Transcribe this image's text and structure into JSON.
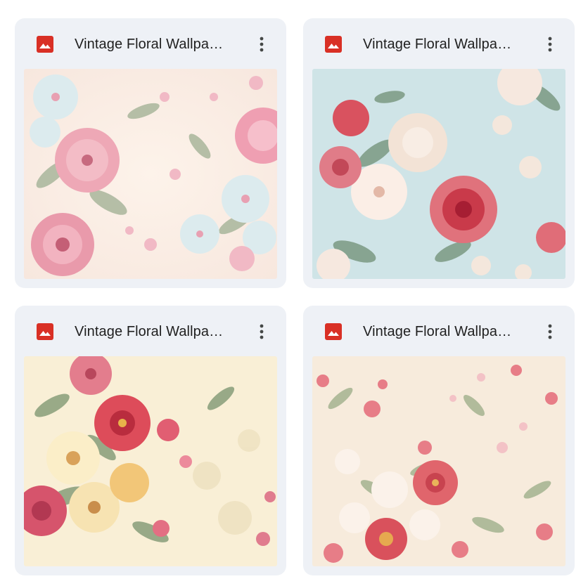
{
  "files": [
    {
      "title": "Vintage Floral Wallpa…",
      "icon": "image-file-icon",
      "menu_icon": "more-vertical-icon",
      "thumbnail_alt": "Vintage floral wallpaper with pink and white flowers on cream"
    },
    {
      "title": "Vintage Floral Wallpa…",
      "icon": "image-file-icon",
      "menu_icon": "more-vertical-icon",
      "thumbnail_alt": "Vintage floral wallpaper with red and cream roses on light blue"
    },
    {
      "title": "Vintage Floral Wallpa…",
      "icon": "image-file-icon",
      "menu_icon": "more-vertical-icon",
      "thumbnail_alt": "Vintage floral wallpaper with red, pink and yellow flowers on cream"
    },
    {
      "title": "Vintage Floral Wallpa…",
      "icon": "image-file-icon",
      "menu_icon": "more-vertical-icon",
      "thumbnail_alt": "Vintage floral wallpaper with small coral blossoms on cream"
    }
  ],
  "colors": {
    "card_bg": "#eef1f6",
    "icon_red": "#d93025",
    "title_text": "#1f1f1f",
    "menu_dots": "#444746"
  }
}
